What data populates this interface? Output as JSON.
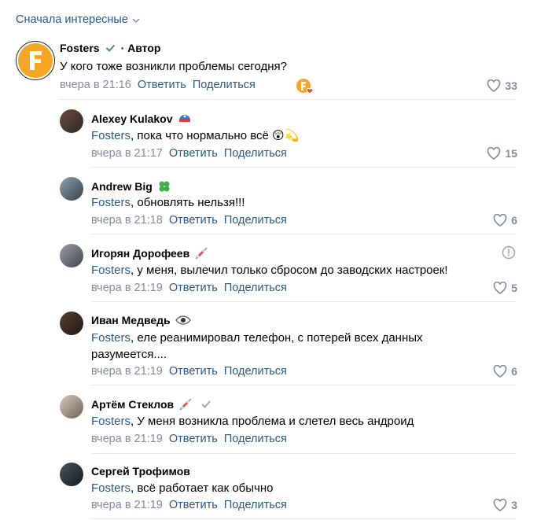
{
  "sort": {
    "label": "Сначала интересные"
  },
  "actions": {
    "reply": "Ответить",
    "share": "Поделиться"
  },
  "root": {
    "name": "Fosters",
    "verified": true,
    "author_label": "· Автор",
    "text": "У кого тоже возникли проблемы сегодня?",
    "date": "вчера в 21:16",
    "likes": "33",
    "avatar_letter": "F",
    "liker_avatar_letter": "F"
  },
  "replies": [
    {
      "name": "Alexey Kulakov",
      "mention": "Fosters",
      "text": ", пока что нормально всё 😲💫",
      "date": "вчера в 21:17",
      "likes": "15",
      "badge_icon": "helmet-icon"
    },
    {
      "name": "Andrew Big",
      "mention": "Fosters",
      "text": ", обновлять нельзя!!!",
      "date": "вчера в 21:18",
      "likes": "6",
      "badge_icon": "clover-icon"
    },
    {
      "name": "Игорян Дорофеев",
      "mention": "Fosters",
      "text": ", у меня, вылечил только сбросом до заводских настроек!",
      "date": "вчера в 21:19",
      "likes": "5",
      "badge_icon": "syringe-icon"
    },
    {
      "name": "Иван Медведь",
      "mention": "Fosters",
      "text": ", еле реанимировал телефон, с потерей всех данных разумеется....",
      "date": "вчера в 21:19",
      "likes": "6",
      "badge_icon": "eye-icon"
    },
    {
      "name": "Артём Стеклов",
      "mention": "Fosters",
      "text": ", У меня возникла проблема и слетел весь андроид",
      "date": "вчера в 21:19",
      "likes": "",
      "badge_icon": "syringe-icon"
    },
    {
      "name": "Сергей Трофимов",
      "mention": "Fosters",
      "text": ", всё работает как обычно",
      "date": "вчера в 21:19",
      "likes": "3",
      "badge_icon": ""
    }
  ],
  "colors": {
    "link": "#2a5885",
    "meta": "#818c99",
    "divider": "#e7e8ec",
    "brand_orange": "#f5a623"
  }
}
